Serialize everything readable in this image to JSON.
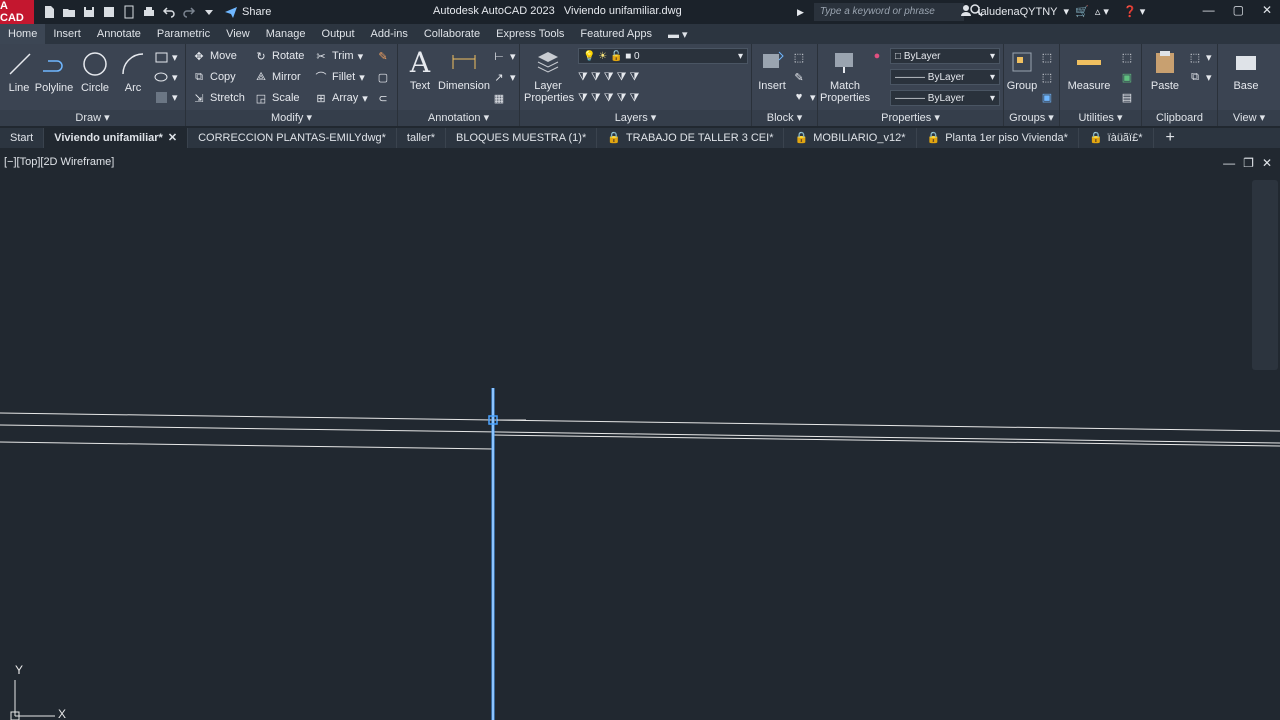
{
  "app": {
    "logo": "A CAD",
    "title": "Autodesk AutoCAD 2023",
    "filename": "Viviendo unifamiliar.dwg",
    "share_label": "Share"
  },
  "search": {
    "placeholder": "Type a keyword or phrase"
  },
  "user": {
    "name": "ialudenaQYTNY"
  },
  "menu_tabs": [
    "Home",
    "Insert",
    "Annotate",
    "Parametric",
    "View",
    "Manage",
    "Output",
    "Add-ins",
    "Collaborate",
    "Express Tools",
    "Featured Apps"
  ],
  "ribbon": {
    "draw": {
      "title": "Draw",
      "line": "Line",
      "polyline": "Polyline",
      "circle": "Circle",
      "arc": "Arc"
    },
    "modify": {
      "title": "Modify",
      "move": "Move",
      "rotate": "Rotate",
      "trim": "Trim",
      "copy": "Copy",
      "mirror": "Mirror",
      "fillet": "Fillet",
      "stretch": "Stretch",
      "scale": "Scale",
      "array": "Array"
    },
    "annotation": {
      "title": "Annotation",
      "text": "Text",
      "dimension": "Dimension"
    },
    "layers": {
      "title": "Layers",
      "layer_properties": "Layer Properties",
      "current_layer": "0"
    },
    "block": {
      "title": "Block",
      "insert": "Insert"
    },
    "properties": {
      "title": "Properties",
      "match": "Match Properties",
      "color": "ByLayer",
      "linetype": "ByLayer",
      "lineweight": "ByLayer"
    },
    "groups": {
      "title": "Groups",
      "group": "Group"
    },
    "utilities": {
      "title": "Utilities",
      "measure": "Measure"
    },
    "clipboard": {
      "title": "Clipboard",
      "paste": "Paste"
    },
    "view": {
      "title": "View",
      "base": "Base"
    }
  },
  "doc_tabs": [
    {
      "label": "Start",
      "locked": false
    },
    {
      "label": "Viviendo unifamiliar*",
      "locked": false,
      "active": true,
      "close": "✕"
    },
    {
      "label": "CORRECCION PLANTAS-EMILYdwg*",
      "locked": false
    },
    {
      "label": "taller*",
      "locked": false
    },
    {
      "label": "BLOQUES MUESTRA (1)*",
      "locked": false
    },
    {
      "label": "TRABAJO DE TALLER 3 CEI*",
      "locked": true
    },
    {
      "label": "MOBILIARIO_v12*",
      "locked": true
    },
    {
      "label": "Planta 1er piso Vivienda*",
      "locked": true
    },
    {
      "label": "ïàüãï£*",
      "locked": true
    }
  ],
  "viewport": {
    "label": "[−][Top][2D Wireframe]",
    "ucs_y": "Y",
    "ucs_x": "X"
  },
  "colors": {
    "accent": "#4aa3ff",
    "canvas": "#212830",
    "ribbon": "#3b4452"
  }
}
